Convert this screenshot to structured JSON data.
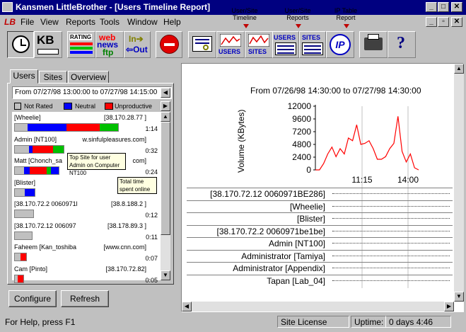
{
  "window": {
    "title": "Kansmen LittleBrother - [Users Timeline Report]"
  },
  "menu": {
    "logo": "LB",
    "items": [
      "File",
      "View",
      "Reports",
      "Tools",
      "Window",
      "Help"
    ]
  },
  "toolbar": {
    "kb_label": "KB",
    "rating_label": "RATING",
    "web_label": "web",
    "news_label": "news",
    "ftp_label": "ftp",
    "in_label": "In",
    "out_label": "Out",
    "users_label": "USERS",
    "sites_label": "SITES",
    "ip_label": "IP"
  },
  "callouts": {
    "timeline": "User/Site Timeline",
    "reports": "User/Site Reports",
    "iptable": "IP Table Report"
  },
  "tabs": [
    "Users",
    "Sites",
    "Overview"
  ],
  "panel": {
    "range": "From  07/27/98 13:00:00  to  07/27/98 14:15:00",
    "legend": {
      "not_rated": "Not Rated",
      "neutral": "Neutral",
      "unproductive": "Unproductive"
    },
    "colors": {
      "not_rated": "#c0c0c0",
      "neutral": "#0000ff",
      "unproductive": "#ff0000",
      "productive": "#00c000"
    },
    "tooltips": {
      "top_site": "Top Site for user Admin on Computer NT100",
      "total_time": "Total time spent online"
    },
    "users": [
      {
        "name": "[Wheelie]",
        "site": "[38.170.28.77 ]",
        "time": "1:14",
        "bar": [
          {
            "c": "not_rated",
            "w": 18
          },
          {
            "c": "neutral",
            "w": 55
          },
          {
            "c": "unproductive",
            "w": 47
          },
          {
            "c": "productive",
            "w": 26
          },
          {
            "c": "not_rated",
            "w": 0
          }
        ]
      },
      {
        "name": "Admin [NT100]",
        "site": "w.sinfulpleasures.com]",
        "time": "0:32",
        "bar": [
          {
            "c": "not_rated",
            "w": 20
          },
          {
            "c": "neutral",
            "w": 5
          },
          {
            "c": "unproductive",
            "w": 29
          },
          {
            "c": "productive",
            "w": 15
          }
        ]
      },
      {
        "name": "Matt  [Chonch_sa",
        "site": "com]",
        "time": "0:24",
        "bar": [
          {
            "c": "not_rated",
            "w": 13
          },
          {
            "c": "neutral",
            "w": 8
          },
          {
            "c": "unproductive",
            "w": 24
          },
          {
            "c": "productive",
            "w": 6
          },
          {
            "c": "neutral",
            "w": 11
          }
        ]
      },
      {
        "name": "[Blister]",
        "site": "[NT100.k",
        "time": "",
        "bar": [
          {
            "c": "not_rated",
            "w": 14
          },
          {
            "c": "neutral",
            "w": 14
          }
        ]
      },
      {
        "name": "[38.170.72.2 0060971l",
        "site": "[38.8.188.2 ]",
        "time": "0:12",
        "bar": [
          {
            "c": "not_rated",
            "w": 26
          }
        ]
      },
      {
        "name": "[38.170.72.12 006097",
        "site": "[38.178.89.3 ]",
        "time": "0:11",
        "bar": [
          {
            "c": "not_rated",
            "w": 24
          }
        ]
      },
      {
        "name": "Faheem  [Kan_toshiba",
        "site": "[www.cnn.com]",
        "time": "0:07",
        "bar": [
          {
            "c": "not_rated",
            "w": 8
          },
          {
            "c": "unproductive",
            "w": 8
          }
        ]
      },
      {
        "name": "Cam  [Pinto]",
        "site": "[38.170.72.82]",
        "time": "0:05",
        "bar": [
          {
            "c": "not_rated",
            "w": 4
          },
          {
            "c": "unproductive",
            "w": 8
          }
        ]
      }
    ]
  },
  "buttons": {
    "configure": "Configure",
    "refresh": "Refresh"
  },
  "chart_data": {
    "type": "line",
    "title": "From  07/26/98 14:30:00  to  07/27/98 14:30:00",
    "ylabel": "Volume (KBytes)",
    "yticks": [
      "12000",
      "9600",
      "7200",
      "4800",
      "2400",
      "0"
    ],
    "ylim": [
      0,
      12000
    ],
    "xticks": [
      "11:15",
      "14:00"
    ],
    "color": "#ff0000",
    "values": [
      0,
      0,
      1200,
      3000,
      4300,
      2500,
      4000,
      3000,
      6000,
      5500,
      8500,
      4800,
      5000,
      5500,
      4000,
      2000,
      2000,
      2500,
      4000,
      5000,
      10100,
      3500,
      1500,
      3000,
      400,
      0
    ]
  },
  "hosts": [
    "[38.170.72.12 0060971BE286]",
    "[Wheelie]",
    "[Blister]",
    "[38.170.72.2 0060971be1be]",
    "Admin [NT100]",
    "Administrator [Tamiya]",
    "Administrator [Appendix]",
    "Tapan [Lab_04]"
  ],
  "status": {
    "help": "For Help, press F1",
    "license": "Site License",
    "uptime_label": "Uptime:",
    "uptime": "0 days 4:46"
  }
}
